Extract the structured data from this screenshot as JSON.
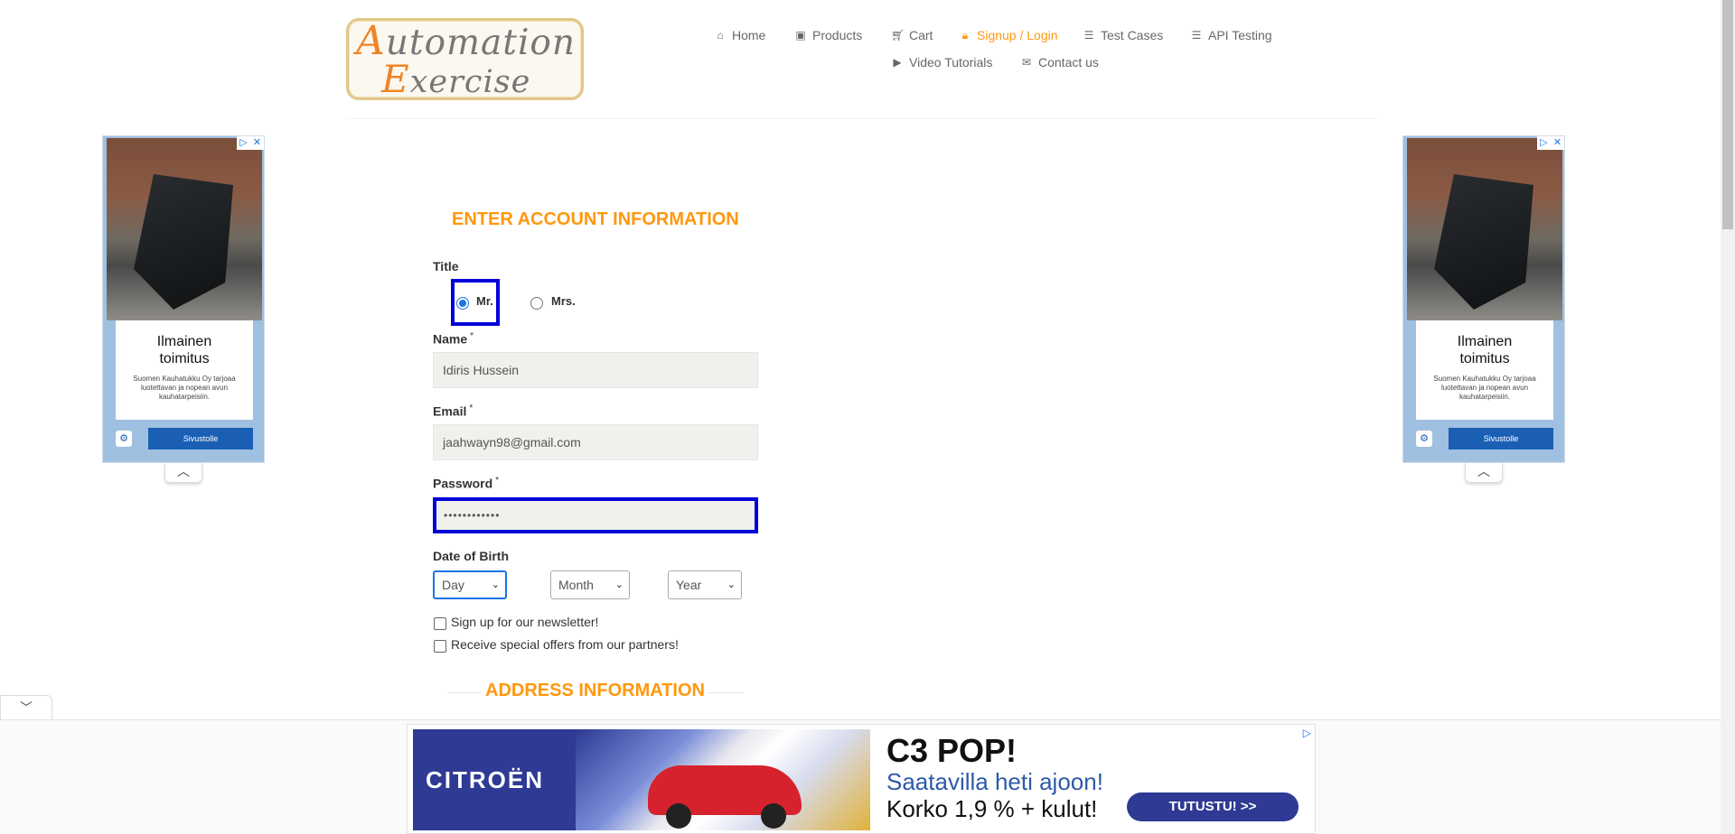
{
  "logo": {
    "line1_cap": "A",
    "line1_rest": "utomation",
    "line2_cap": "E",
    "line2_rest": "xercise"
  },
  "nav": {
    "home": "Home",
    "products": "Products",
    "cart": "Cart",
    "signup": "Signup / Login",
    "test_cases": "Test Cases",
    "api_testing": "API Testing",
    "video_tutorials": "Video Tutorials",
    "contact": "Contact us"
  },
  "side_ad": {
    "title_line1": "Ilmainen",
    "title_line2": "toimitus",
    "description": "Suomen Kauhatukku Oy tarjoaa luotettavan ja nopean avun kauhatarpeisiin.",
    "button": "Sivustolle"
  },
  "form": {
    "heading": "ENTER ACCOUNT INFORMATION",
    "title_label": "Title",
    "title_options": [
      "Mr.",
      "Mrs."
    ],
    "selected_title": "Mr.",
    "name_label": "Name",
    "name_value": "Idiris Hussein",
    "email_label": "Email",
    "email_value": "jaahwayn98@gmail.com",
    "password_label": "Password",
    "password_value": "••••••••••••",
    "required_mark": "*",
    "dob_label": "Date of Birth",
    "day_value": "Day",
    "month_value": "Month",
    "year_value": "Year",
    "newsletter_label": "Sign up for our newsletter!",
    "offers_label": "Receive special offers from our partners!",
    "address_heading": "ADDRESS INFORMATION"
  },
  "banner": {
    "brand": "CITROËN",
    "headline": "C3 POP!",
    "subline": "Saatavilla heti ajoon!",
    "rate": "Korko 1,9 % + kulut!",
    "cta": "TUTUSTU! >>"
  },
  "colors": {
    "accent": "#fe980f",
    "focus": "#0000d8",
    "link": "#696763"
  }
}
